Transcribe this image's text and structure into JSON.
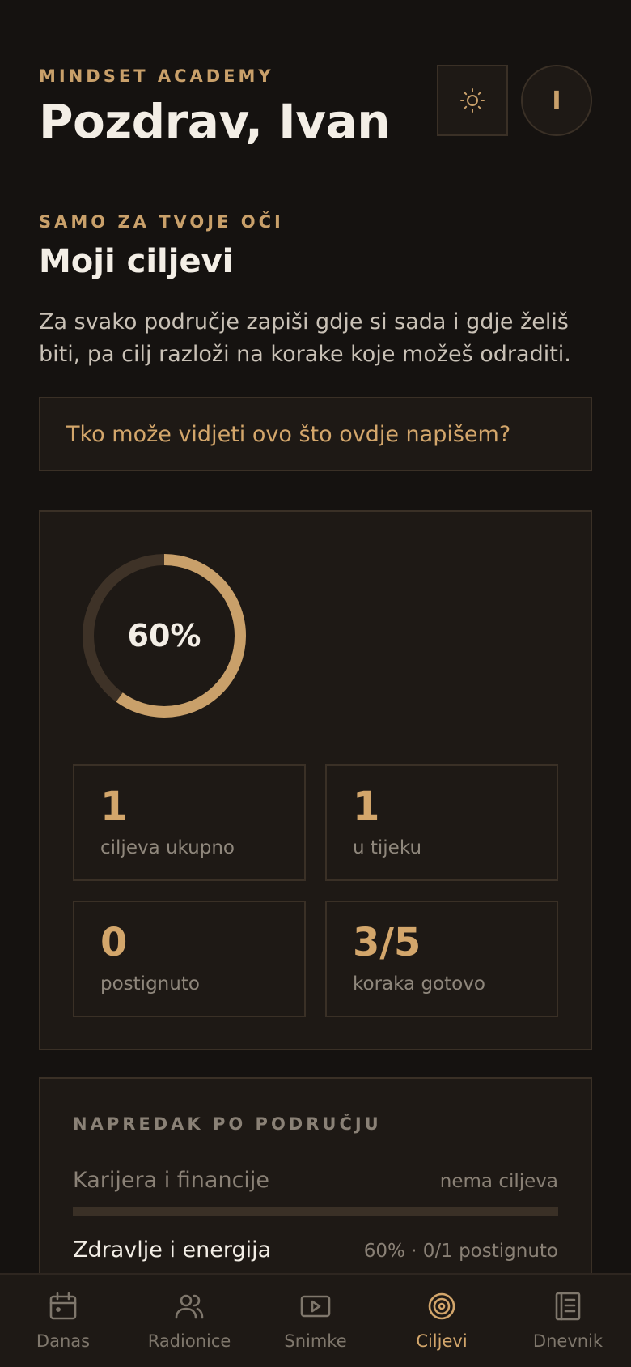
{
  "header": {
    "brand": "MINDSET ACADEMY",
    "greeting": "Pozdrav, Ivan",
    "avatar_initial": "I",
    "theme_icon": "sun-icon"
  },
  "section": {
    "eyebrow": "SAMO ZA TVOJE OČI",
    "title": "Moji ciljevi",
    "intro": "Za svako područje zapiši gdje si sada i gdje želiš biti, pa cilj razloži na korake koje možeš odraditi.",
    "question": "Tko može vidjeti ovo što ovdje napišem?"
  },
  "summary": {
    "progress_percent": 60,
    "progress_label": "60%",
    "stats": [
      {
        "value": "1",
        "label": "ciljeva ukupno"
      },
      {
        "value": "1",
        "label": "u tijeku"
      },
      {
        "value": "0",
        "label": "postignuto"
      },
      {
        "value": "3/5",
        "label": "koraka gotovo"
      }
    ]
  },
  "progress_by_area": {
    "title": "NAPREDAK PO PODRUČJU",
    "areas": [
      {
        "name": "Karijera i financije",
        "meta": "nema ciljeva",
        "percent": 0
      },
      {
        "name": "Zdravlje i energija",
        "meta": "60% · 0/1 postignuto",
        "percent": 60
      }
    ]
  },
  "tabs": [
    {
      "label": "Danas",
      "icon": "calendar-icon",
      "active": false
    },
    {
      "label": "Radionice",
      "icon": "users-icon",
      "active": false
    },
    {
      "label": "Snimke",
      "icon": "play-icon",
      "active": false
    },
    {
      "label": "Ciljevi",
      "icon": "target-icon",
      "active": true
    },
    {
      "label": "Dnevnik",
      "icon": "journal-icon",
      "active": false
    }
  ],
  "colors": {
    "accent": "#c9a06a",
    "background": "#151210",
    "card": "#1e1915",
    "border": "#3a3026"
  }
}
